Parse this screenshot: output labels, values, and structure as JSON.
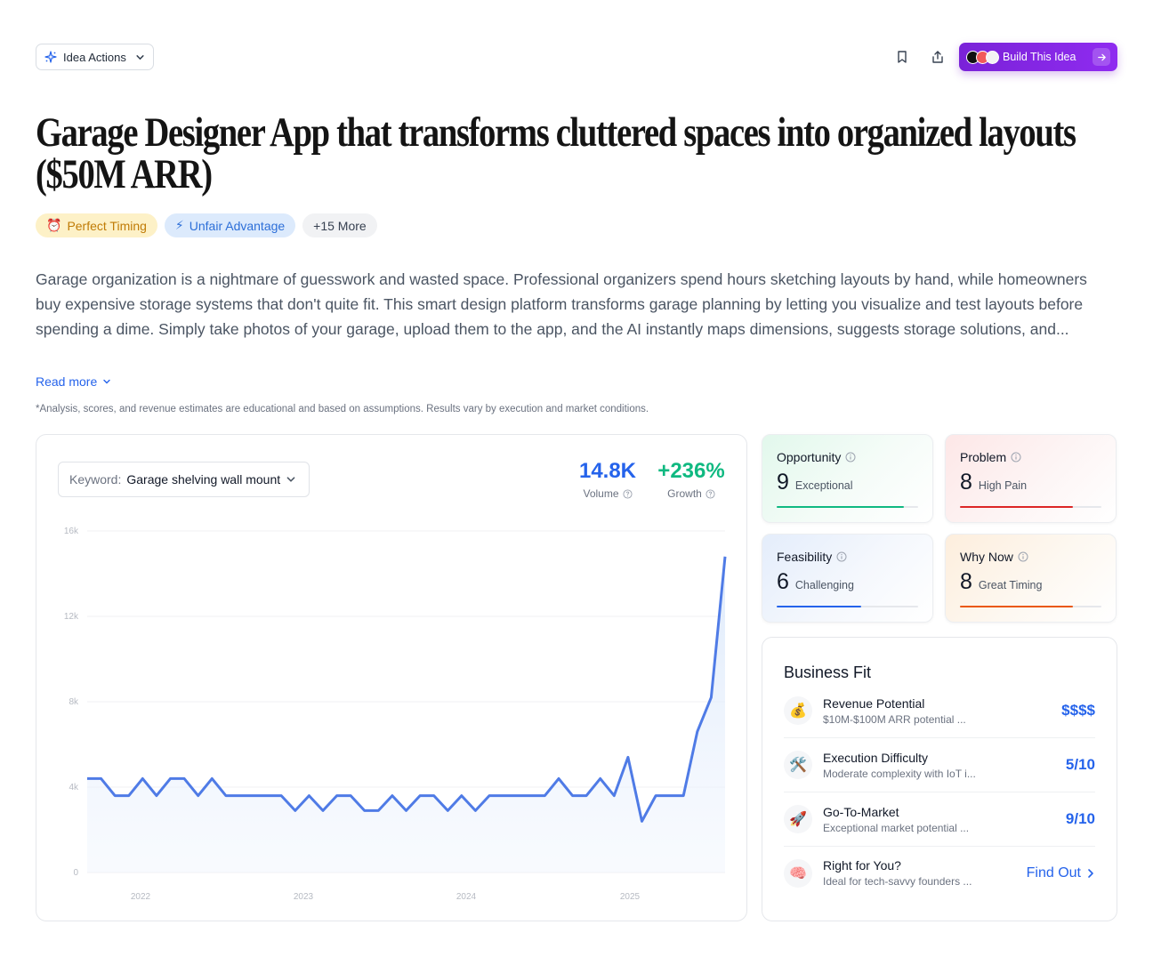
{
  "header": {
    "idea_actions_label": "Idea Actions",
    "build_label": "Build This Idea"
  },
  "title": "Garage Designer App that transforms cluttered spaces into organized layouts ($50M ARR)",
  "tags": [
    {
      "icon": "⏰",
      "label": "Perfect Timing"
    },
    {
      "icon": "⚡",
      "label": "Unfair Advantage"
    },
    {
      "label": "+15 More"
    }
  ],
  "description": "Garage organization is a nightmare of guesswork and wasted space. Professional organizers spend hours sketching layouts by hand, while homeowners buy expensive storage systems that don't quite fit. This smart design platform transforms garage planning by letting you visualize and test layouts before spending a dime. Simply take photos of your garage, upload them to the app, and the AI instantly maps dimensions, suggests storage solutions, and...",
  "read_more_label": "Read more",
  "disclaimer": "*Analysis, scores, and revenue estimates are educational and based on assumptions. Results vary by execution and market conditions.",
  "keyword": {
    "label": "Keyword:",
    "value": "Garage shelving wall mount"
  },
  "metrics": {
    "volume_value": "14.8K",
    "volume_label": "Volume",
    "growth_value": "+236%",
    "growth_label": "Growth"
  },
  "chart_data": {
    "type": "area",
    "x_ticks": [
      "2022",
      "2023",
      "2024",
      "2025"
    ],
    "y_ticks": [
      "0",
      "4k",
      "8k",
      "12k",
      "16k"
    ],
    "ylim": [
      0,
      16000
    ],
    "line_color": "#4f7be6",
    "values": [
      4400,
      4400,
      3600,
      3600,
      4400,
      3600,
      4400,
      4400,
      3600,
      4400,
      3600,
      3600,
      3600,
      3600,
      3600,
      2900,
      3600,
      2900,
      3600,
      3600,
      2900,
      2900,
      3600,
      2900,
      3600,
      3600,
      2900,
      3600,
      2900,
      3600,
      3600,
      3600,
      3600,
      3600,
      4400,
      3600,
      3600,
      4400,
      3600,
      5400,
      2400,
      3600,
      3600,
      3600,
      6600,
      8200,
      14800
    ]
  },
  "scores": [
    {
      "title": "Opportunity",
      "value": "9",
      "label": "Exceptional",
      "fraction": 0.9,
      "color": "#10b981"
    },
    {
      "title": "Problem",
      "value": "8",
      "label": "High Pain",
      "fraction": 0.8,
      "color": "#dc2626"
    },
    {
      "title": "Feasibility",
      "value": "6",
      "label": "Challenging",
      "fraction": 0.6,
      "color": "#2563eb"
    },
    {
      "title": "Why Now",
      "value": "8",
      "label": "Great Timing",
      "fraction": 0.8,
      "color": "#ea580c"
    }
  ],
  "business_fit": {
    "title": "Business Fit",
    "items": [
      {
        "icon": "💰",
        "name": "Revenue Potential",
        "desc": "$10M-$100M ARR potential ...",
        "value": "$$$$"
      },
      {
        "icon": "🛠️",
        "name": "Execution Difficulty",
        "desc": "Moderate complexity with IoT i...",
        "value": "5/10"
      },
      {
        "icon": "🚀",
        "name": "Go-To-Market",
        "desc": "Exceptional market potential ...",
        "value": "9/10"
      },
      {
        "icon": "🧠",
        "name": "Right for You?",
        "desc": "Ideal for tech-savvy founders ...",
        "value": "Find Out"
      }
    ]
  }
}
